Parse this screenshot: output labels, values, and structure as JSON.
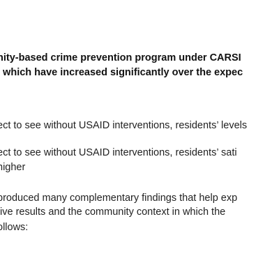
{
  "document": {
    "lines": [
      "nity-based crime prevention program under CARSI",
      ", which have increased significantly over the expec",
      "ect to see without USAID interventions, residents’ levels",
      "ect to see without USAID interventions, residents’ sati",
      " higher",
      " produced many complementary findings that help exp",
      "tive results and the community context in which the",
      "ollows:"
    ]
  }
}
